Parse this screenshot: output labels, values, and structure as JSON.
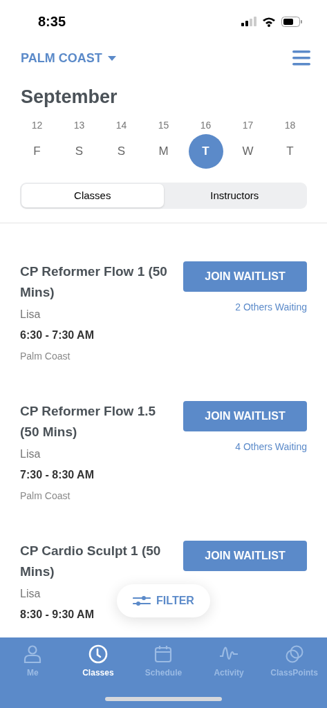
{
  "status_bar": {
    "time": "8:35"
  },
  "header": {
    "location": "PALM COAST"
  },
  "month": "September",
  "days": [
    {
      "date": "12",
      "weekday": "F",
      "selected": false
    },
    {
      "date": "13",
      "weekday": "S",
      "selected": false
    },
    {
      "date": "14",
      "weekday": "S",
      "selected": false
    },
    {
      "date": "15",
      "weekday": "M",
      "selected": false
    },
    {
      "date": "16",
      "weekday": "T",
      "selected": true
    },
    {
      "date": "17",
      "weekday": "W",
      "selected": false
    },
    {
      "date": "18",
      "weekday": "T",
      "selected": false
    }
  ],
  "tabs": [
    {
      "label": "Classes",
      "selected": true
    },
    {
      "label": "Instructors",
      "selected": false
    }
  ],
  "classes": [
    {
      "title": "CP Reformer Flow 1 (50 Mins)",
      "instructor": "Lisa",
      "time": "6:30 - 7:30 AM",
      "location": "Palm Coast",
      "button": "JOIN WAITLIST",
      "waiting": "2 Others Waiting"
    },
    {
      "title": "CP Reformer Flow 1.5 (50 Mins)",
      "instructor": "Lisa",
      "time": "7:30 - 8:30 AM",
      "location": "Palm Coast",
      "button": "JOIN WAITLIST",
      "waiting": "4 Others Waiting"
    },
    {
      "title": "CP Cardio Sculpt 1 (50 Mins)",
      "instructor": "Lisa",
      "time": "8:30 - 9:30 AM",
      "button": "JOIN WAITLIST"
    }
  ],
  "filter_button": "FILTER",
  "nav": [
    {
      "kind": "person",
      "label": "Me",
      "selected": false
    },
    {
      "kind": "clock",
      "label": "Classes",
      "selected": true
    },
    {
      "kind": "calendar",
      "label": "Schedule",
      "selected": false
    },
    {
      "kind": "pulse",
      "label": "Activity",
      "selected": false
    },
    {
      "kind": "circles",
      "label": "ClassPoints",
      "selected": false
    }
  ]
}
